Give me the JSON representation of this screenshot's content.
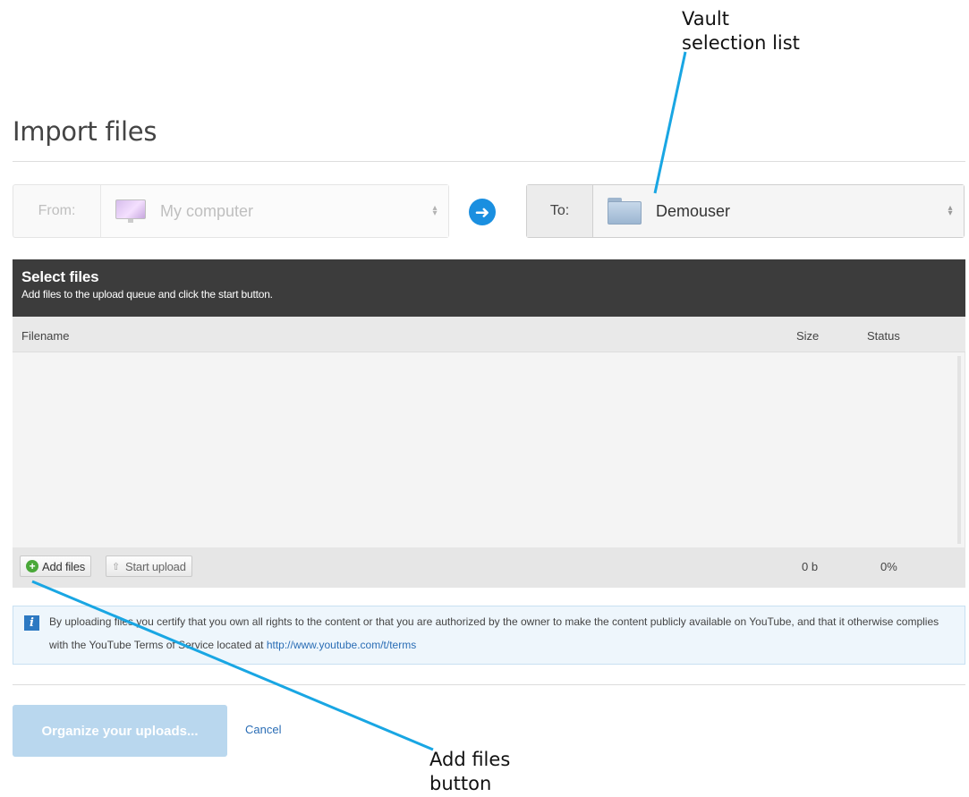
{
  "callouts": {
    "vault": "Vault\nselection list",
    "add_files": "Add files\nbutton"
  },
  "page": {
    "title": "Import files"
  },
  "from": {
    "label": "From:",
    "value": "My computer",
    "icon": "monitor-icon"
  },
  "to": {
    "label": "To:",
    "value": "Demouser",
    "icon": "folder-icon"
  },
  "uploader": {
    "title": "Select files",
    "subtitle": "Add files to the upload queue and click the start button.",
    "columns": {
      "filename": "Filename",
      "size": "Size",
      "status": "Status"
    },
    "add_files_label": "Add files",
    "start_upload_label": "Start upload",
    "total_size": "0 b",
    "total_status": "0%"
  },
  "notice": {
    "text": "By uploading files you certify that you own all rights to the content or that you are authorized by the owner to make the content publicly available on YouTube, and that it otherwise complies with the YouTube Terms of Service located at ",
    "link": "http://www.youtube.com/t/terms"
  },
  "actions": {
    "organize_label": "Organize your uploads...",
    "cancel_label": "Cancel"
  },
  "colors": {
    "accent": "#1a8fe0",
    "header_bg": "#3c3c3c",
    "callout_line": "#19a6e3"
  }
}
